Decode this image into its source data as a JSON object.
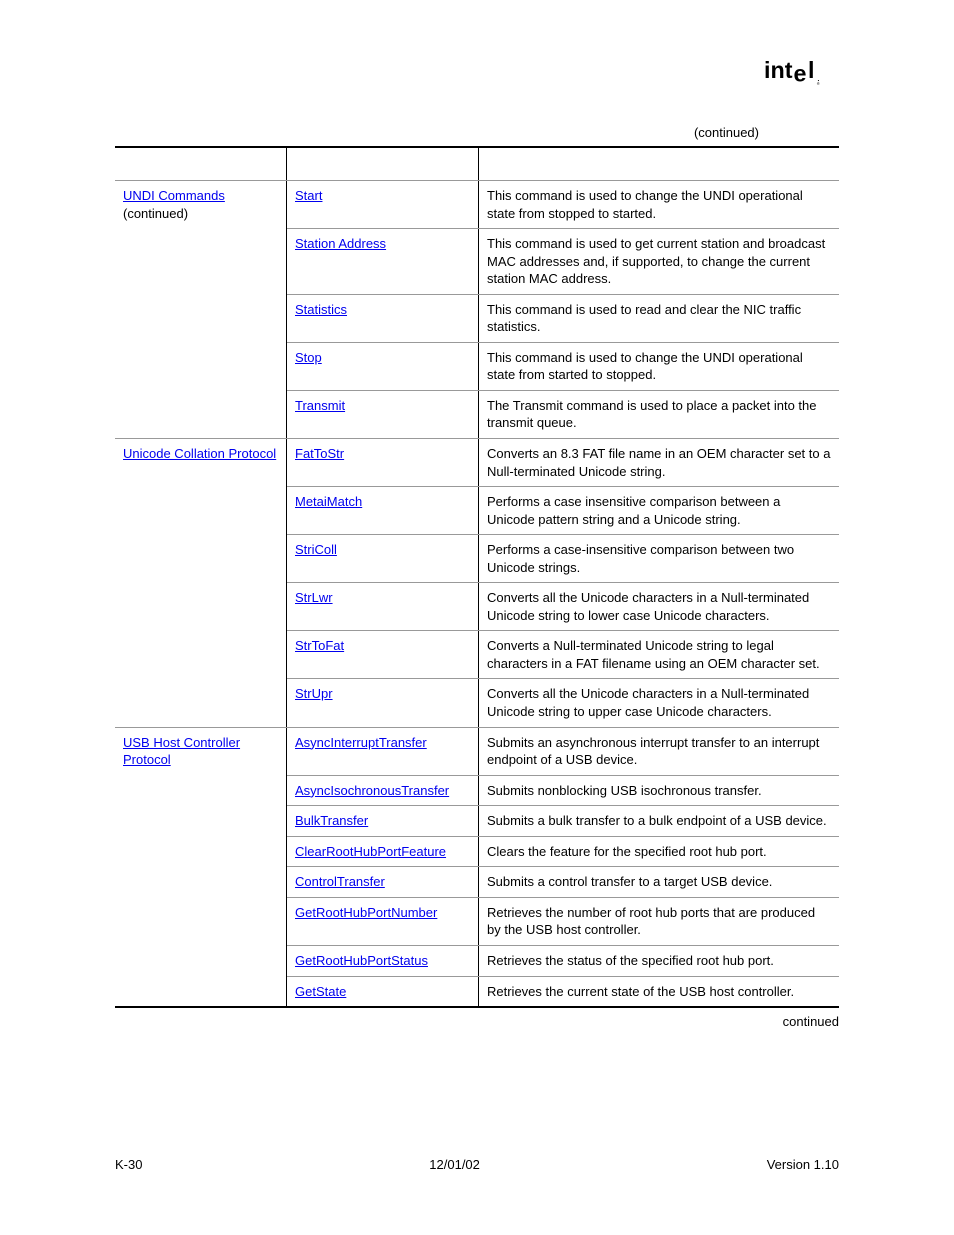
{
  "logo_name": "intel-logo",
  "continued_top": "(continued)",
  "continued_bottom": "continued",
  "footer": {
    "left": "K-30",
    "center": "12/01/02",
    "right": "Version 1.10"
  },
  "sections": [
    {
      "title": "UNDI Commands",
      "suffix": " (continued)",
      "section_top": false,
      "rows": [
        {
          "name": "Start",
          "desc": "This command is used to change the UNDI operational state from stopped to started."
        },
        {
          "name": "Station Address",
          "desc": "This command is used to get current station and broadcast MAC addresses and, if supported, to change the current station MAC address."
        },
        {
          "name": "Statistics",
          "desc": "This command is used to read and clear the NIC traffic statistics."
        },
        {
          "name": "Stop",
          "desc": "This command is used to change the UNDI operational state from started to stopped."
        },
        {
          "name": "Transmit",
          "desc": "The Transmit command is used to place a packet into the transmit queue."
        }
      ]
    },
    {
      "title": "Unicode Collation Protocol",
      "suffix": "",
      "section_top": true,
      "rows": [
        {
          "name": "FatToStr",
          "desc": "Converts an 8.3 FAT file name in an OEM character set to a Null-terminated Unicode string."
        },
        {
          "name": "MetaiMatch",
          "desc": "Performs a case insensitive comparison between a Unicode pattern string and a Unicode string."
        },
        {
          "name": "StriColl",
          "desc": "Performs a case-insensitive comparison between two Unicode strings."
        },
        {
          "name": "StrLwr",
          "desc": "Converts all the Unicode characters in a Null-terminated Unicode string to lower case Unicode characters."
        },
        {
          "name": "StrToFat",
          "desc": "Converts a Null-terminated Unicode string to legal characters in a FAT filename using an OEM character set."
        },
        {
          "name": "StrUpr",
          "desc": "Converts all the Unicode characters in a Null-terminated Unicode string to upper case Unicode characters."
        }
      ]
    },
    {
      "title": "USB Host Controller Protocol",
      "suffix": "",
      "section_top": true,
      "rows": [
        {
          "name": "AsyncInterruptTransfer",
          "desc": "Submits an asynchronous interrupt transfer to an interrupt endpoint of a USB device."
        },
        {
          "name": "AsyncIsochronousTransfer",
          "desc": "Submits nonblocking USB isochronous transfer."
        },
        {
          "name": "BulkTransfer",
          "desc": "Submits a bulk transfer to a bulk endpoint of a USB device."
        },
        {
          "name": "ClearRootHubPortFeature",
          "desc": "Clears the feature for the specified root hub port."
        },
        {
          "name": "ControlTransfer",
          "desc": "Submits a control transfer to a target USB device."
        },
        {
          "name": "GetRootHubPortNumber",
          "desc": "Retrieves the number of root hub ports that are produced by the USB host controller."
        },
        {
          "name": "GetRootHubPortStatus",
          "desc": "Retrieves the status of the specified root hub port."
        },
        {
          "name": "GetState",
          "desc": "Retrieves the current state of the USB host controller."
        }
      ]
    }
  ]
}
